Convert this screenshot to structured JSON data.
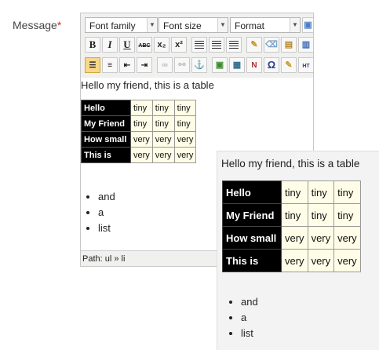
{
  "field": {
    "label": "Message",
    "required_mark": "*"
  },
  "toolbar": {
    "font_family": "Font family",
    "font_size": "Font size",
    "format": "Format",
    "bold": "B",
    "italic": "I",
    "underline": "U",
    "strike": "ABC",
    "subscript": "x₂",
    "superscript": "x²",
    "omega": "Ω",
    "ht": "HT"
  },
  "editor": {
    "intro": "Hello my friend, this is a table",
    "table": [
      [
        "Hello",
        "tiny",
        "tiny",
        "tiny"
      ],
      [
        "My Friend",
        "tiny",
        "tiny",
        "tiny"
      ],
      [
        "How small",
        "very",
        "very",
        "very"
      ],
      [
        "This is",
        "very",
        "very",
        "very"
      ]
    ],
    "list": [
      "and",
      "a",
      "list"
    ],
    "path": "Path: ul » li"
  },
  "preview": {
    "intro": "Hello my friend, this is a table",
    "table": [
      [
        "Hello",
        "tiny",
        "tiny",
        "tiny"
      ],
      [
        "My Friend",
        "tiny",
        "tiny",
        "tiny"
      ],
      [
        "How small",
        "very",
        "very",
        "very"
      ],
      [
        "This is",
        "very",
        "very",
        "very"
      ]
    ],
    "list": [
      "and",
      "a",
      "list"
    ]
  },
  "colors": {
    "required": "#d62a2a",
    "header_cell": "#000000",
    "body_cell": "#fffde7",
    "active_button": "#f7d88a"
  }
}
